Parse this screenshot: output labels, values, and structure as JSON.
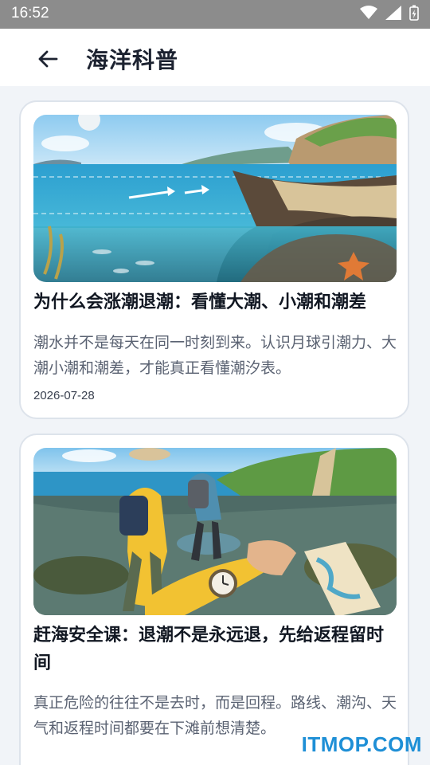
{
  "status_bar": {
    "time": "16:52"
  },
  "app_bar": {
    "title": "海洋科普"
  },
  "articles": [
    {
      "title": "为什么会涨潮退潮：看懂大潮、小潮和潮差",
      "description": "潮水并不是每天在同一时刻到来。认识月球引潮力、大潮小潮和潮差，才能真正看懂潮汐表。",
      "date": "2026-07-28",
      "image": "coastline-tide-illustration"
    },
    {
      "title": "赶海安全课：退潮不是永远退，先给返程留时间",
      "description": "真正危险的往往不是去时，而是回程。路线、潮沟、天气和返程时间都要在下滩前想清楚。",
      "image": "tidal-flat-hikers-illustration"
    }
  ],
  "watermark": "ITMOP.COM",
  "colors": {
    "accent": "#1e8fd6",
    "card_border": "#dde3eb",
    "background": "#f1f4f8"
  }
}
